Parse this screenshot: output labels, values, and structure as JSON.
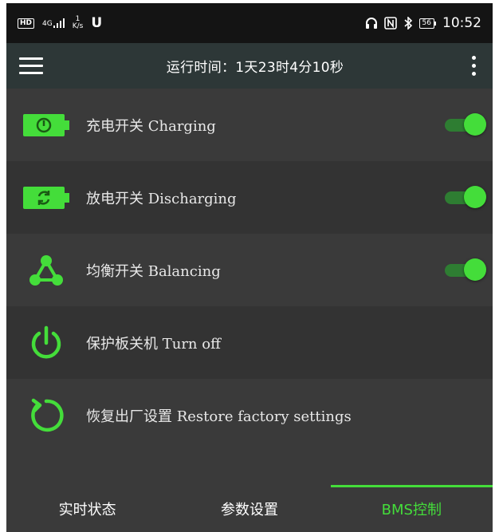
{
  "statusbar": {
    "sim_badge": "HD",
    "network": "4G",
    "speed_value": "1",
    "speed_unit": "K/s",
    "app_icon": "U",
    "battery": "56",
    "time": "10:52"
  },
  "toolbar": {
    "runtime": "运行时间：1天23时4分10秒"
  },
  "rows": [
    {
      "label": "充电开关  Charging",
      "icon": "battery-charging-icon",
      "toggle": true
    },
    {
      "label": "放电开关  Discharging",
      "icon": "battery-discharging-icon",
      "toggle": true
    },
    {
      "label": "均衡开关  Balancing",
      "icon": "balance-icon",
      "toggle": true
    },
    {
      "label": "保护板关机  Turn off",
      "icon": "power-icon",
      "toggle": false
    },
    {
      "label": "恢复出厂设置  Restore factory settings",
      "icon": "restore-icon",
      "toggle": false
    }
  ],
  "tabs": [
    {
      "label": "实时状态"
    },
    {
      "label": "参数设置"
    },
    {
      "label": "BMS控制",
      "active": true
    }
  ],
  "colors": {
    "accent": "#44dd3a",
    "background": "#3a3a3a",
    "toolbar": "#2d3737",
    "statusbar": "#141414"
  }
}
